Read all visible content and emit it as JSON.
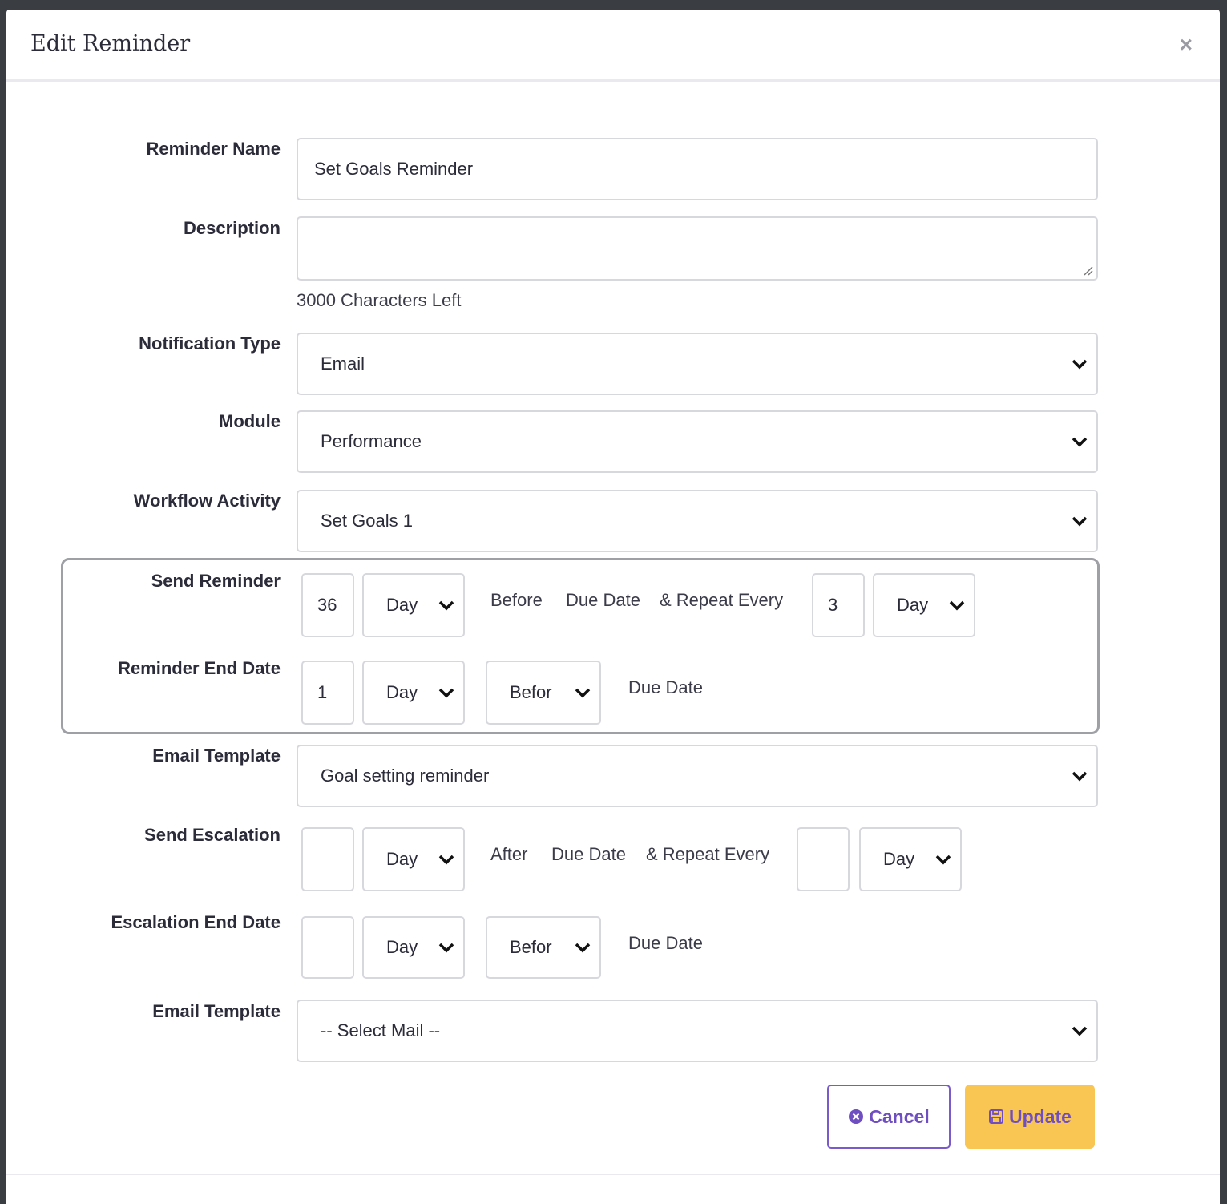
{
  "dialog": {
    "title": "Edit Reminder",
    "close_label": "×"
  },
  "fields": {
    "reminder_name": {
      "label": "Reminder Name",
      "value": "Set Goals Reminder"
    },
    "description": {
      "label": "Description",
      "value": "",
      "chars_left": "3000 Characters Left"
    },
    "notification_type": {
      "label": "Notification Type",
      "value": "Email"
    },
    "module": {
      "label": "Module",
      "value": "Performance"
    },
    "workflow_activity": {
      "label": "Workflow Activity",
      "value": "Set Goals 1"
    }
  },
  "send_reminder": {
    "label": "Send Reminder",
    "count": "36",
    "unit": "Day",
    "before_text": "Before",
    "due_date_text": "Due Date",
    "repeat_text": "& Repeat Every",
    "repeat_count": "3",
    "repeat_unit": "Day"
  },
  "reminder_end_date": {
    "label": "Reminder End Date",
    "count": "1",
    "unit": "Day",
    "relation": "Befor",
    "due_date_text": "Due Date"
  },
  "email_template_1": {
    "label": "Email Template",
    "value": "Goal setting reminder"
  },
  "send_escalation": {
    "label": "Send Escalation",
    "count": "",
    "unit": "Day",
    "after_text": "After",
    "due_date_text": "Due Date",
    "repeat_text": "& Repeat Every",
    "repeat_count": "",
    "repeat_unit": "Day"
  },
  "escalation_end_date": {
    "label": "Escalation End Date",
    "count": "",
    "unit": "Day",
    "relation": "Befor",
    "due_date_text": "Due Date"
  },
  "email_template_2": {
    "label": "Email Template",
    "value": "-- Select Mail --"
  },
  "buttons": {
    "cancel": "Cancel",
    "update": "Update"
  },
  "colors": {
    "accent": "#6f4ec2",
    "update_bg": "#f9c553",
    "border": "#d7d7de"
  }
}
